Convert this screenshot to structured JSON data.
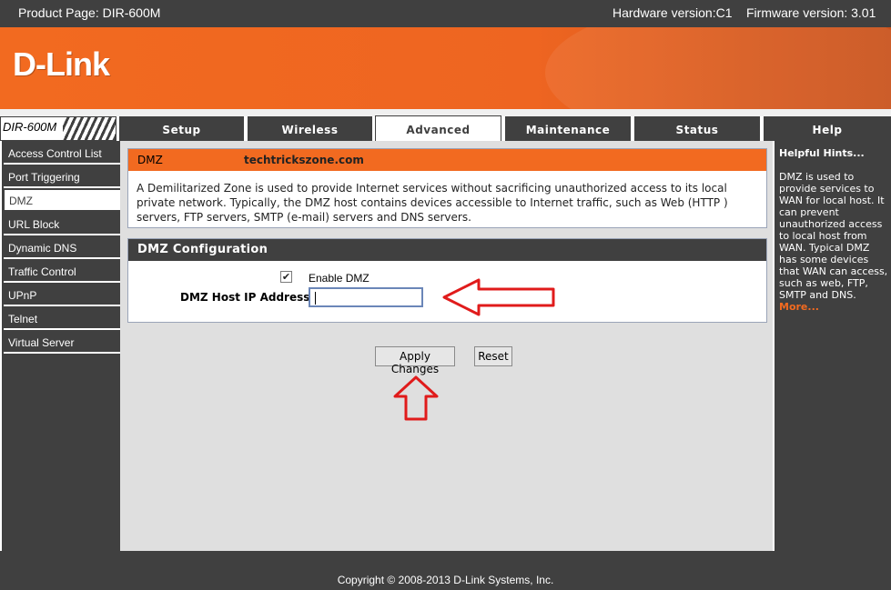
{
  "topbar": {
    "product": "Product Page: DIR-600M",
    "hardware": "Hardware version:C1",
    "firmware": "Firmware version: 3.01"
  },
  "brand": {
    "logo": "D-Link",
    "model": "DIR-600M"
  },
  "tabs": [
    {
      "label": "Setup",
      "active": false
    },
    {
      "label": "Wireless",
      "active": false
    },
    {
      "label": "Advanced",
      "active": true
    },
    {
      "label": "Maintenance",
      "active": false
    },
    {
      "label": "Status",
      "active": false
    },
    {
      "label": "Help",
      "active": false
    }
  ],
  "sidebar": {
    "items": [
      {
        "label": "Access Control List",
        "active": false
      },
      {
        "label": "Port Triggering",
        "active": false
      },
      {
        "label": "DMZ",
        "active": true
      },
      {
        "label": "URL Block",
        "active": false
      },
      {
        "label": "Dynamic DNS",
        "active": false
      },
      {
        "label": "Traffic Control",
        "active": false
      },
      {
        "label": "UPnP",
        "active": false
      },
      {
        "label": "Telnet",
        "active": false
      },
      {
        "label": "Virtual Server",
        "active": false
      }
    ]
  },
  "dmz_info": {
    "title": "DMZ",
    "watermark": "techtrickszone.com",
    "description": "A Demilitarized Zone is used to provide Internet services without sacrificing unauthorized access to its local private network. Typically, the DMZ host contains devices accessible to Internet traffic, such as Web (HTTP ) servers, FTP servers, SMTP (e-mail) servers and DNS servers."
  },
  "dmz_config": {
    "title": "DMZ Configuration",
    "enable_label": "Enable DMZ",
    "enable_checked": true,
    "ip_label": "DMZ Host IP Address:",
    "ip_value": ""
  },
  "buttons": {
    "apply": "Apply Changes",
    "reset": "Reset"
  },
  "hints": {
    "title": "Helpful Hints...",
    "text": "DMZ is used to provide services to WAN for local host. It can prevent unauthorized access to local host from WAN. Typical DMZ has some devices that WAN can access, such as web, FTP, SMTP and DNS.",
    "more": "More..."
  },
  "footer": {
    "copyright": "Copyright © 2008-2013 D-Link Systems, Inc."
  },
  "colors": {
    "orange": "#f26a20",
    "dark": "#404040",
    "annotation_red": "#e01b1b"
  },
  "icons": {
    "checkbox": "check-icon"
  }
}
